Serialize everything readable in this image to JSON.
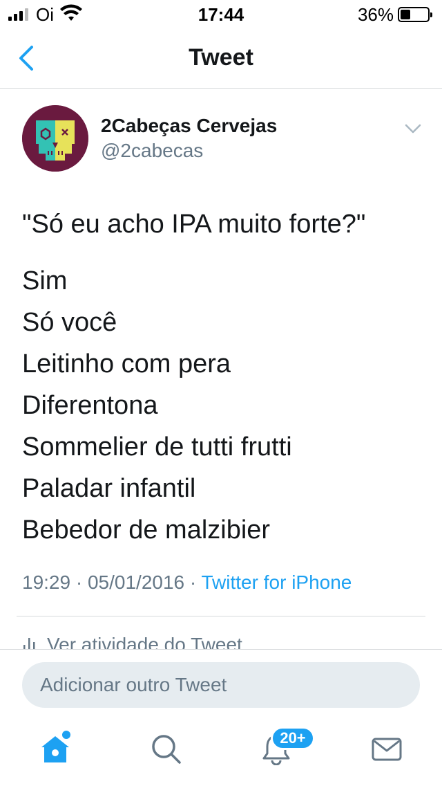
{
  "status_bar": {
    "carrier": "Oi",
    "time": "17:44",
    "battery_percent": "36%",
    "battery_level": 0.36
  },
  "nav": {
    "back_icon": "chevron-left-icon",
    "title": "Tweet"
  },
  "tweet": {
    "author": {
      "name": "2Cabeças Cervejas",
      "handle": "@2cabecas",
      "avatar_icon": "skull-logo"
    },
    "quote": "\"Só eu acho IPA muito forte?\"",
    "lines": [
      "Sim",
      "Só você",
      "Leitinho com pera",
      "Diferentona",
      "Sommelier de tutti frutti",
      "Paladar infantil",
      "Bebedor de malzibier"
    ],
    "time": "19:29",
    "separator": "·",
    "date": "05/01/2016",
    "source": "Twitter for iPhone",
    "activity_label": "Ver atividade do Tweet"
  },
  "reply": {
    "placeholder": "Adicionar outro Tweet"
  },
  "tab_bar": {
    "items": [
      {
        "icon": "home-icon",
        "active": true
      },
      {
        "icon": "search-icon",
        "active": false
      },
      {
        "icon": "bell-icon",
        "active": false
      },
      {
        "icon": "mail-icon",
        "active": false
      }
    ],
    "notifications_badge": "20+"
  },
  "colors": {
    "accent": "#1da1f2",
    "text": "#14171a",
    "secondary": "#657786",
    "divider": "#d6d9db",
    "avatar_bg": "#6a1a3f",
    "avatar_teal": "#33c2b4",
    "avatar_yellow": "#e7e25a"
  }
}
